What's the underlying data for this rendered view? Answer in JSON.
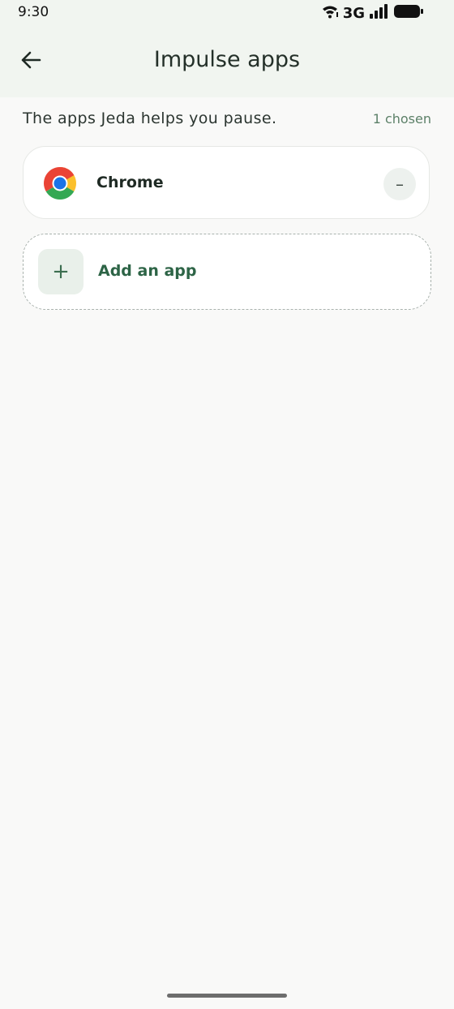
{
  "status_bar": {
    "time": "9:30",
    "network": "3G",
    "icons": [
      "wifi-icon",
      "cell-signal-icon",
      "battery-icon"
    ]
  },
  "app_bar": {
    "title": "Impulse apps",
    "back_icon": "arrow-left-icon"
  },
  "subtitle": {
    "text": "The apps Jeda helps you pause.",
    "count": "1 chosen"
  },
  "apps": [
    {
      "name": "Chrome",
      "icon": "chrome-icon",
      "remove_label": "–"
    }
  ],
  "add_app": {
    "label": "Add an app",
    "icon_glyph": "+"
  },
  "colors": {
    "background": "#f9f9f8",
    "header_bg": "#f1f5f0",
    "accent_green": "#2d6446",
    "muted_green": "#5c8068"
  }
}
